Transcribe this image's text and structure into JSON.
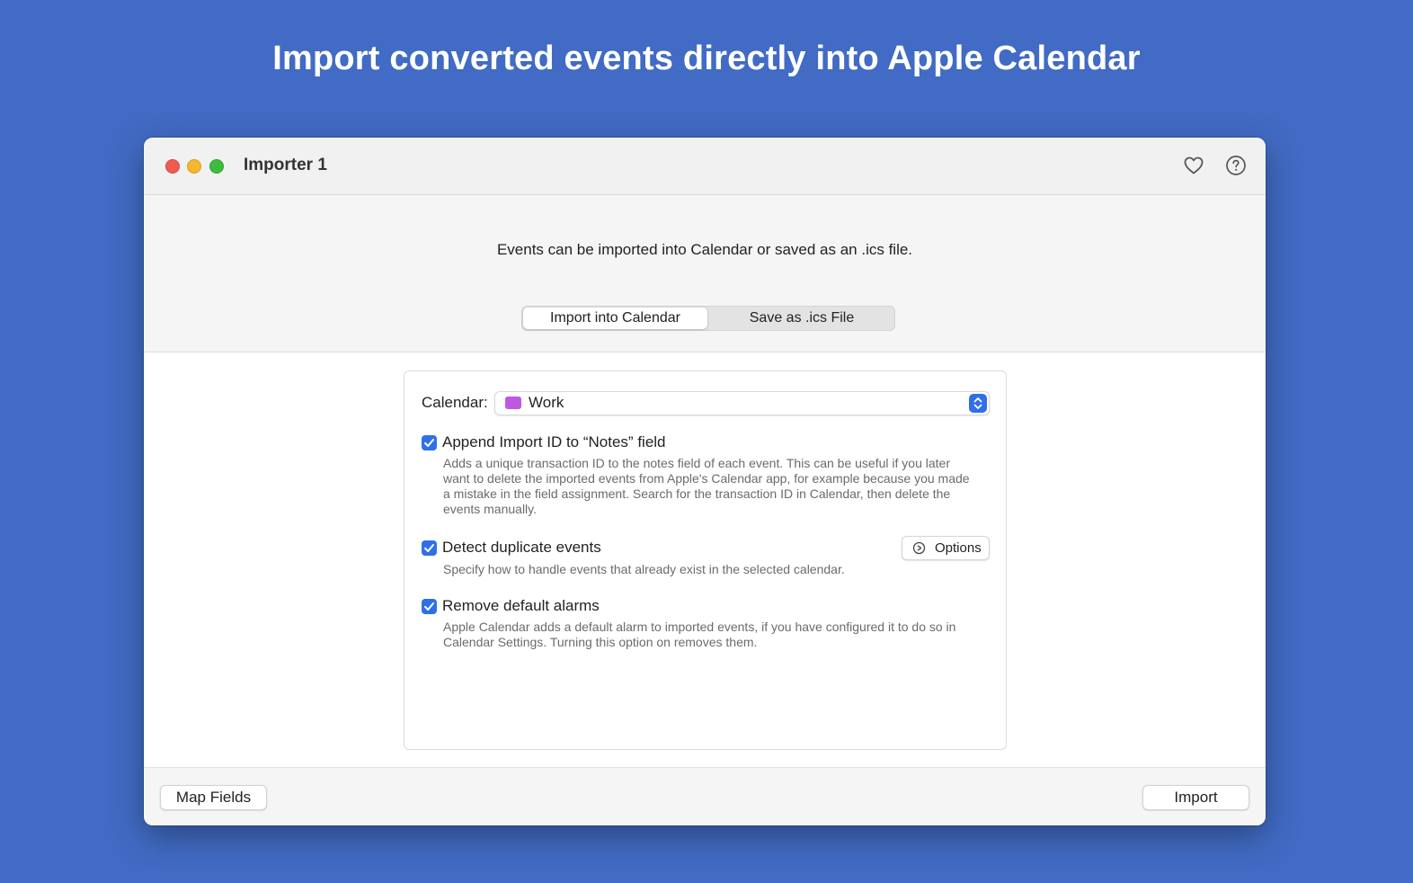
{
  "headline": "Import converted events directly into Apple Calendar",
  "window": {
    "title": "Importer 1",
    "toolbar_icons": [
      "heart-icon",
      "help-icon"
    ]
  },
  "intro": "Events can be imported into Calendar or saved as an .ics file.",
  "mode_tabs": {
    "selected": "Import into Calendar",
    "items": [
      "Import into Calendar",
      "Save as .ics File"
    ]
  },
  "calendar": {
    "label": "Calendar:",
    "value": "Work",
    "color": "#bd59e0"
  },
  "options": [
    {
      "title": "Append Import ID to “Notes” field",
      "checked": true,
      "description": [
        "Adds a unique transaction ID to the notes field of each event. This can be useful if you later",
        "want to delete the imported events from Apple's Calendar app, for example because you made",
        "a mistake in the field assignment. Search for the transaction ID in Calendar, then delete the",
        "events manually."
      ]
    },
    {
      "title": "Detect duplicate events",
      "checked": true,
      "description": [
        "Specify how to handle events that already exist in the selected calendar."
      ],
      "button_label": "Options"
    },
    {
      "title": "Remove default alarms",
      "checked": true,
      "description": [
        "Apple Calendar adds a default alarm to imported events, if you have configured it to do so in",
        "Calendar Settings. Turning this option on removes them."
      ]
    }
  ],
  "footer": {
    "map_fields_label": "Map Fields",
    "import_label": "Import"
  },
  "colors": {
    "background": "#416bc4",
    "accent": "#2f6fea"
  }
}
